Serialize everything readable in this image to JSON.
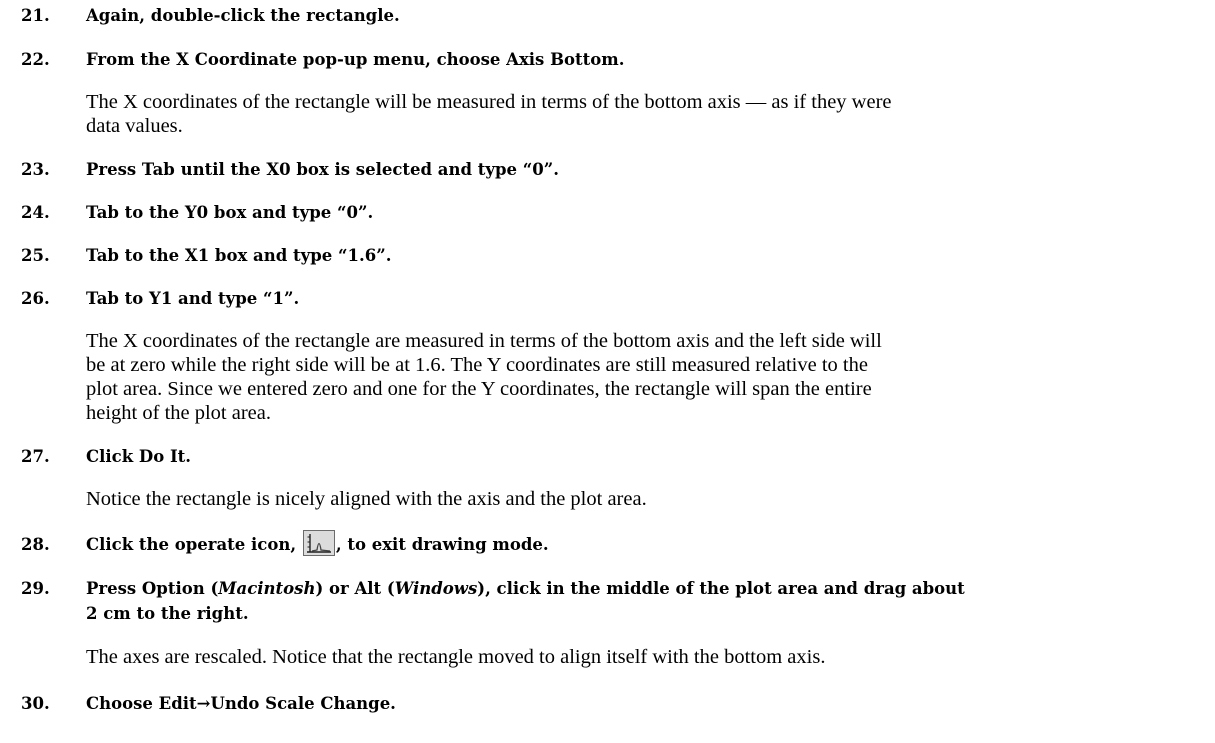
{
  "steps": {
    "s21": {
      "num": "21.",
      "text": "Again, double-click the rectangle."
    },
    "s22": {
      "num": "22.",
      "text": "From the X Coordinate pop-up menu, choose Axis Bottom."
    },
    "p22a": "The X coordinates of the rectangle will be measured in terms of the bottom axis — as if they were",
    "p22b": "data values.",
    "s23": {
      "num": "23.",
      "text": "Press Tab until the X0 box is selected and type “0”."
    },
    "s24": {
      "num": "24.",
      "text": "Tab to the Y0 box and type “0”."
    },
    "s25": {
      "num": "25.",
      "text": "Tab to the X1 box and type “1.6”."
    },
    "s26": {
      "num": "26.",
      "text": "Tab to Y1 and type “1”."
    },
    "p26a": "The X coordinates of the rectangle are measured in terms of the bottom axis and the left side will",
    "p26b": "be at zero while the right side will be at 1.6. The Y coordinates are still measured relative to the",
    "p26c": "plot area. Since we entered zero and one for the Y coordinates, the rectangle will span the entire",
    "p26d": "height of the plot area.",
    "s27": {
      "num": "27.",
      "text": "Click Do It."
    },
    "p27": "Notice the rectangle is nicely aligned with the axis and the plot area.",
    "s28": {
      "num": "28.",
      "pre": "Click the operate icon,",
      "post": ", to exit drawing mode.",
      "icon": "operate-icon"
    },
    "s29": {
      "num": "29.",
      "part1": "Press Option (",
      "mac": "Macintosh",
      "part2": ") or Alt (",
      "win": "Windows",
      "part3": "), click in the middle of the plot area and drag about",
      "line2": "2 cm to the right."
    },
    "p29": "The axes are rescaled. Notice that the rectangle moved to align itself with the bottom axis.",
    "s30": {
      "num": "30.",
      "text": "Choose Edit→Undo Scale Change."
    }
  }
}
